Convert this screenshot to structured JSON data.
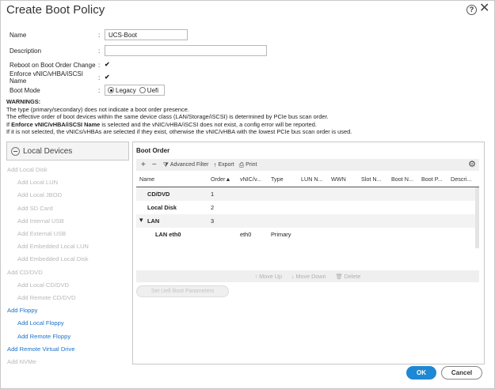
{
  "dialog": {
    "title": "Create Boot Policy",
    "help_glyph": "?",
    "close_glyph": "✕"
  },
  "form": {
    "name_label": "Name",
    "name_value": "UCS-Boot",
    "description_label": "Description",
    "description_value": "",
    "reboot_label": "Reboot on Boot Order Change",
    "reboot_checked": true,
    "enforce_label": "Enforce vNIC/vHBA/iSCSI Name",
    "enforce_checked": true,
    "boot_mode_label": "Boot Mode",
    "boot_mode_options": [
      "Legacy",
      "Uefi"
    ],
    "boot_mode_selected": "Legacy",
    "colon": ":",
    "check_glyph": "✔"
  },
  "warnings": {
    "header": "WARNINGS:",
    "line1": "The type (primary/secondary) does not indicate a boot order presence.",
    "line2": "The effective order of boot devices within the same device class (LAN/Storage/iSCSI) is determined by PCIe bus scan order.",
    "line3_pre": "If ",
    "line3_bold": "Enforce vNIC/vHBA/iSCSI Name",
    "line3_post": " is selected and the vNIC/vHBA/iSCSI does not exist, a config error will be reported.",
    "line4": "If it is not selected, the vNICs/vHBAs are selected if they exist, otherwise the vNIC/vHBA with the lowest PCIe bus scan order is used."
  },
  "local_devices": {
    "header": "Local Devices",
    "items": [
      {
        "label": "Add Local Disk",
        "enabled": false,
        "indent": 0
      },
      {
        "label": "Add Local LUN",
        "enabled": false,
        "indent": 1
      },
      {
        "label": "Add Local JBOD",
        "enabled": false,
        "indent": 1
      },
      {
        "label": "Add SD Card",
        "enabled": false,
        "indent": 1
      },
      {
        "label": "Add Internal USB",
        "enabled": false,
        "indent": 1
      },
      {
        "label": "Add External USB",
        "enabled": false,
        "indent": 1
      },
      {
        "label": "Add Embedded Local LUN",
        "enabled": false,
        "indent": 1
      },
      {
        "label": "Add Embedded Local Disk",
        "enabled": false,
        "indent": 1
      },
      {
        "label": "Add CD/DVD",
        "enabled": false,
        "indent": 0
      },
      {
        "label": "Add Local CD/DVD",
        "enabled": false,
        "indent": 1
      },
      {
        "label": "Add Remote CD/DVD",
        "enabled": false,
        "indent": 1
      },
      {
        "label": "Add Floppy",
        "enabled": true,
        "indent": 0
      },
      {
        "label": "Add Local Floppy",
        "enabled": true,
        "indent": 1
      },
      {
        "label": "Add Remote Floppy",
        "enabled": true,
        "indent": 1
      },
      {
        "label": "Add Remote Virtual Drive",
        "enabled": true,
        "indent": 0
      },
      {
        "label": "Add NVMe",
        "enabled": false,
        "indent": 0
      }
    ]
  },
  "boot_order": {
    "title": "Boot Order",
    "toolbar": {
      "add": "+",
      "remove": "−",
      "filter_icon": "⧩",
      "filter": "Advanced Filter",
      "export_icon": "↑",
      "export": "Export",
      "print_icon": "⎙",
      "print": "Print",
      "settings_icon": "⚙"
    },
    "columns": [
      "Name",
      "Order▲",
      "vNIC/v...",
      "Type",
      "LUN N...",
      "WWN",
      "Slot N...",
      "Boot N...",
      "Boot P...",
      "Descri..."
    ],
    "rows": [
      {
        "name": "CD/DVD",
        "order": "1",
        "vnic": "",
        "type": "",
        "level": 0,
        "expander": ""
      },
      {
        "name": "Local Disk",
        "order": "2",
        "vnic": "",
        "type": "",
        "level": 0,
        "expander": ""
      },
      {
        "name": "LAN",
        "order": "3",
        "vnic": "",
        "type": "",
        "level": 0,
        "expander": "▾"
      },
      {
        "name": "LAN eth0",
        "order": "",
        "vnic": "eth0",
        "type": "Primary",
        "level": 1,
        "expander": ""
      }
    ],
    "move_up": "↑ Move Up",
    "move_down": "↓ Move Down",
    "delete": "🗑 Delete",
    "set_uefi": "Set Uefi Boot Parameters"
  },
  "footer": {
    "ok": "OK",
    "cancel": "Cancel"
  }
}
